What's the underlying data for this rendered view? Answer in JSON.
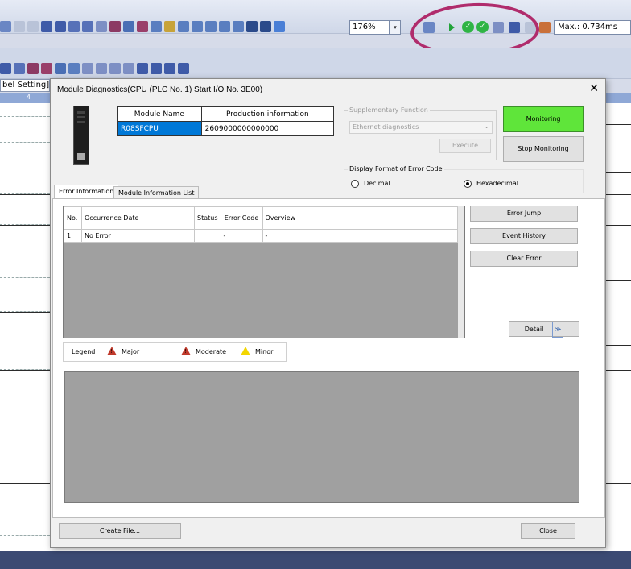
{
  "toolbar": {
    "zoom_value": "176%",
    "zoom_dropdown_glyph": "▾",
    "max_scan": "Max.: 0.734ms",
    "ok_glyph": "✓"
  },
  "background": {
    "tab_label": "bel Setting]",
    "ruler_col": "4"
  },
  "dialog": {
    "title": "Module Diagnostics(CPU (PLC No. 1) Start I/O No. 3E00)",
    "close_glyph": "✕",
    "module_table": {
      "col_name": "Module Name",
      "col_prod": "Production information",
      "name": "R08SFCPU",
      "prod": "2609000000000000"
    },
    "supplementary": {
      "label": "Supplementary Function",
      "selected": "Ethernet diagnostics",
      "dropdown_glyph": "⌄",
      "execute": "Execute"
    },
    "monitoring_button": "Monitoring",
    "stop_monitoring_button": "Stop Monitoring",
    "display_format": {
      "label": "Display Format of Error Code",
      "decimal": "Decimal",
      "hexadecimal": "Hexadecimal",
      "selected": "hexadecimal"
    },
    "tabs": [
      {
        "label": "Error Information",
        "active": true
      },
      {
        "label": "Module Information List",
        "active": false
      }
    ],
    "error_table": {
      "headers": [
        "No.",
        "Occurrence Date",
        "Status",
        "Error Code",
        "Overview"
      ],
      "rows": [
        [
          "1",
          "No Error",
          "",
          "-",
          "-"
        ]
      ]
    },
    "buttons": {
      "error_jump": "Error Jump",
      "event_history": "Event History",
      "clear_error": "Clear Error",
      "detail": "Detail",
      "detail_glyph": "≫",
      "create_file": "Create File...",
      "close": "Close"
    },
    "legend": {
      "label": "Legend",
      "major": "Major",
      "moderate": "Moderate",
      "minor": "Minor",
      "glyph": "!"
    },
    "colors": {
      "monitoring_active": "#5fe53a",
      "selection": "#0078d7",
      "annotation": "#b02c6c"
    }
  }
}
